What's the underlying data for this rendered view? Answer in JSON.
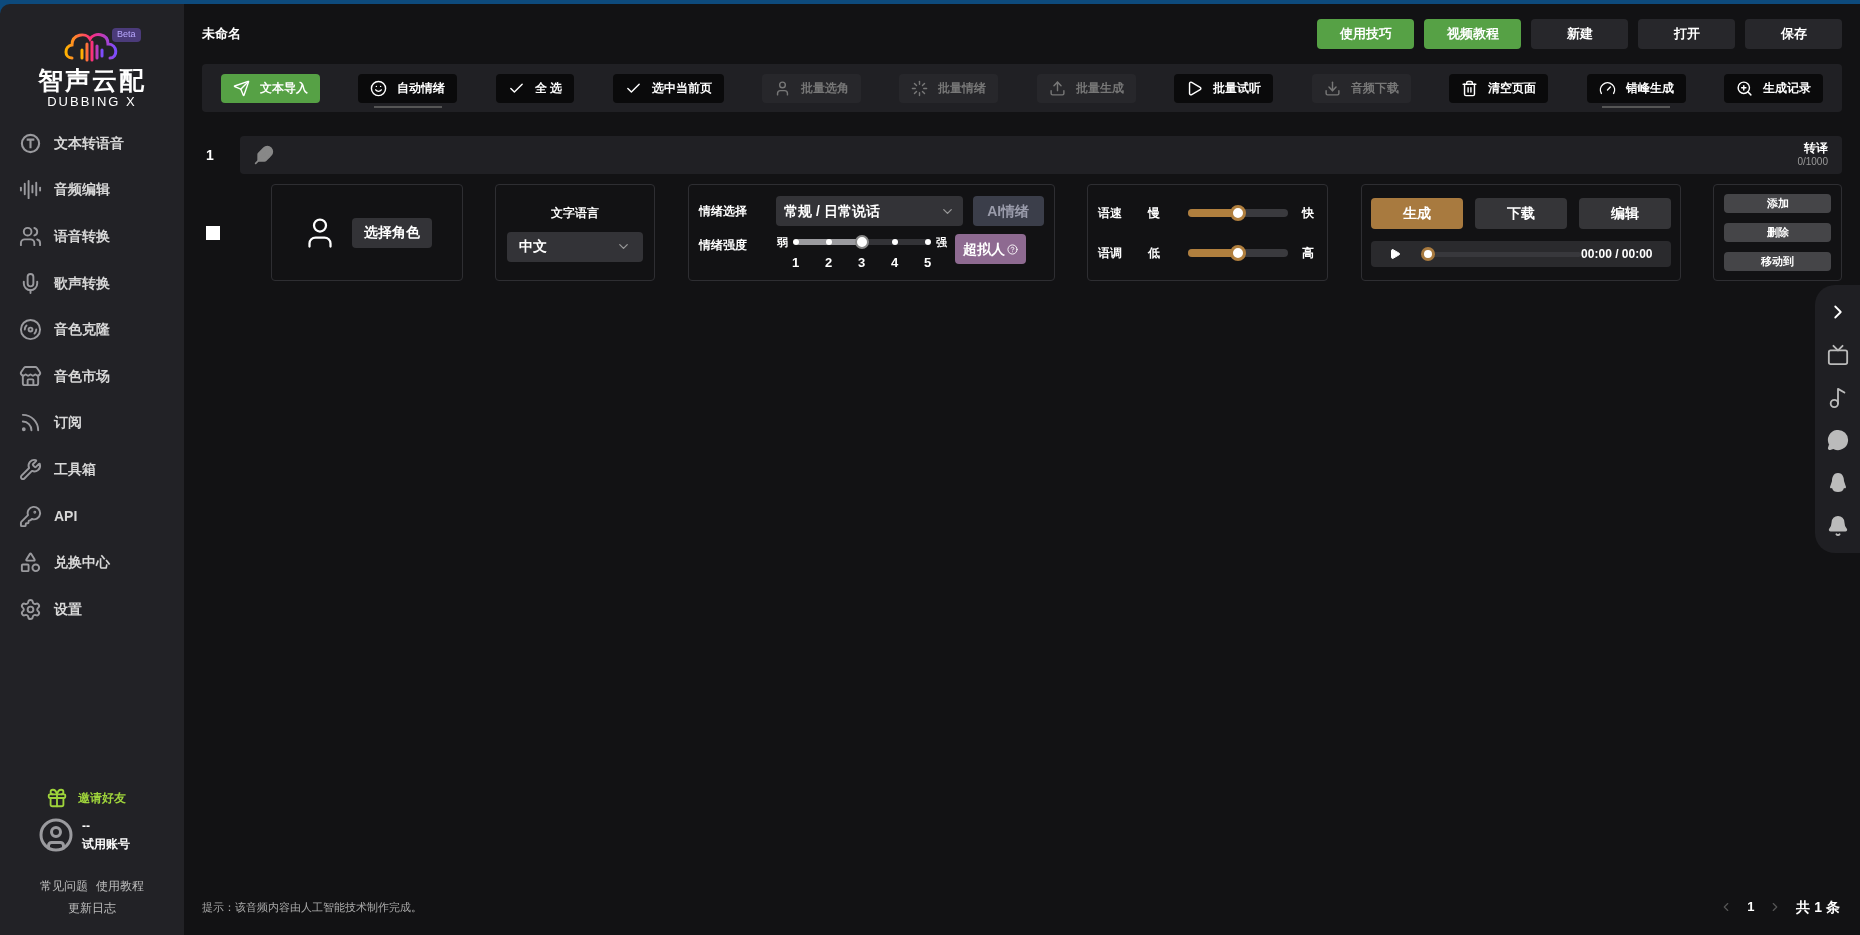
{
  "sidebar": {
    "logo_text": "智声云配",
    "logo_subtext": "DUBBING X",
    "badge": "Beta",
    "items": [
      {
        "label": "文本转语音"
      },
      {
        "label": "音频编辑"
      },
      {
        "label": "语音转换"
      },
      {
        "label": "歌声转换"
      },
      {
        "label": "音色克隆"
      },
      {
        "label": "音色市场"
      },
      {
        "label": "订阅"
      },
      {
        "label": "工具箱"
      },
      {
        "label": "API"
      },
      {
        "label": "兑换中心"
      },
      {
        "label": "设置"
      }
    ],
    "invite": "邀请好友",
    "user": {
      "name": "--",
      "plan": "试用账号"
    },
    "links": [
      "常见问题",
      "使用教程",
      "更新日志"
    ]
  },
  "project_title": "未命名",
  "header_buttons": [
    {
      "label": "使用技巧",
      "kind": "primary"
    },
    {
      "label": "视频教程",
      "kind": "primary"
    },
    {
      "label": "新建",
      "kind": "normal"
    },
    {
      "label": "打开",
      "kind": "normal"
    },
    {
      "label": "保存",
      "kind": "normal"
    }
  ],
  "toolbar": [
    {
      "label": "文本导入",
      "kind": "primary",
      "disabled": false,
      "underlined": false
    },
    {
      "label": "自动情绪",
      "kind": "normal",
      "disabled": false,
      "underlined": true
    },
    {
      "label": "全 选",
      "kind": "normal",
      "disabled": false,
      "underlined": false
    },
    {
      "label": "选中当前页",
      "kind": "normal",
      "disabled": false,
      "underlined": false
    },
    {
      "label": "批量选角",
      "kind": "normal",
      "disabled": true,
      "underlined": false
    },
    {
      "label": "批量情绪",
      "kind": "normal",
      "disabled": true,
      "underlined": false
    },
    {
      "label": "批量生成",
      "kind": "normal",
      "disabled": true,
      "underlined": false
    },
    {
      "label": "批量试听",
      "kind": "normal",
      "disabled": false,
      "underlined": false
    },
    {
      "label": "音频下载",
      "kind": "normal",
      "disabled": true,
      "underlined": false
    },
    {
      "label": "清空页面",
      "kind": "normal",
      "disabled": false,
      "underlined": false
    },
    {
      "label": "错峰生成",
      "kind": "normal",
      "disabled": false,
      "underlined": true
    },
    {
      "label": "生成记录",
      "kind": "normal",
      "disabled": false,
      "underlined": false
    }
  ],
  "rows": [
    {
      "index": "1",
      "checked": false,
      "translate": "转译",
      "count": "0/1000",
      "role_button": "选择角色",
      "language": {
        "label": "文字语言",
        "value": "中文"
      },
      "emotion": {
        "label": "情绪选择",
        "value": "常规 / 日常说话",
        "ai_button": "AI情绪",
        "strength_label": "情绪强度",
        "min": "弱",
        "max": "强",
        "ticks": [
          "1",
          "2",
          "3",
          "4",
          "5"
        ],
        "level": 0.5,
        "hyper_button": "超拟人"
      },
      "speed": {
        "label": "语速",
        "min": "慢",
        "max": "快",
        "level": 0.5
      },
      "pitch": {
        "label": "语调",
        "min": "低",
        "max": "高",
        "level": 0.5
      },
      "generate": "生成",
      "download": "下载",
      "edit": "编辑",
      "player": {
        "time": "00:00 / 00:00",
        "level": 0
      },
      "actions": [
        "添加",
        "删除",
        "移动到"
      ]
    }
  ],
  "footer": {
    "notice": "提示：该音频内容由人工智能技术制作完成。",
    "page": "1",
    "total": "共 1 条"
  }
}
